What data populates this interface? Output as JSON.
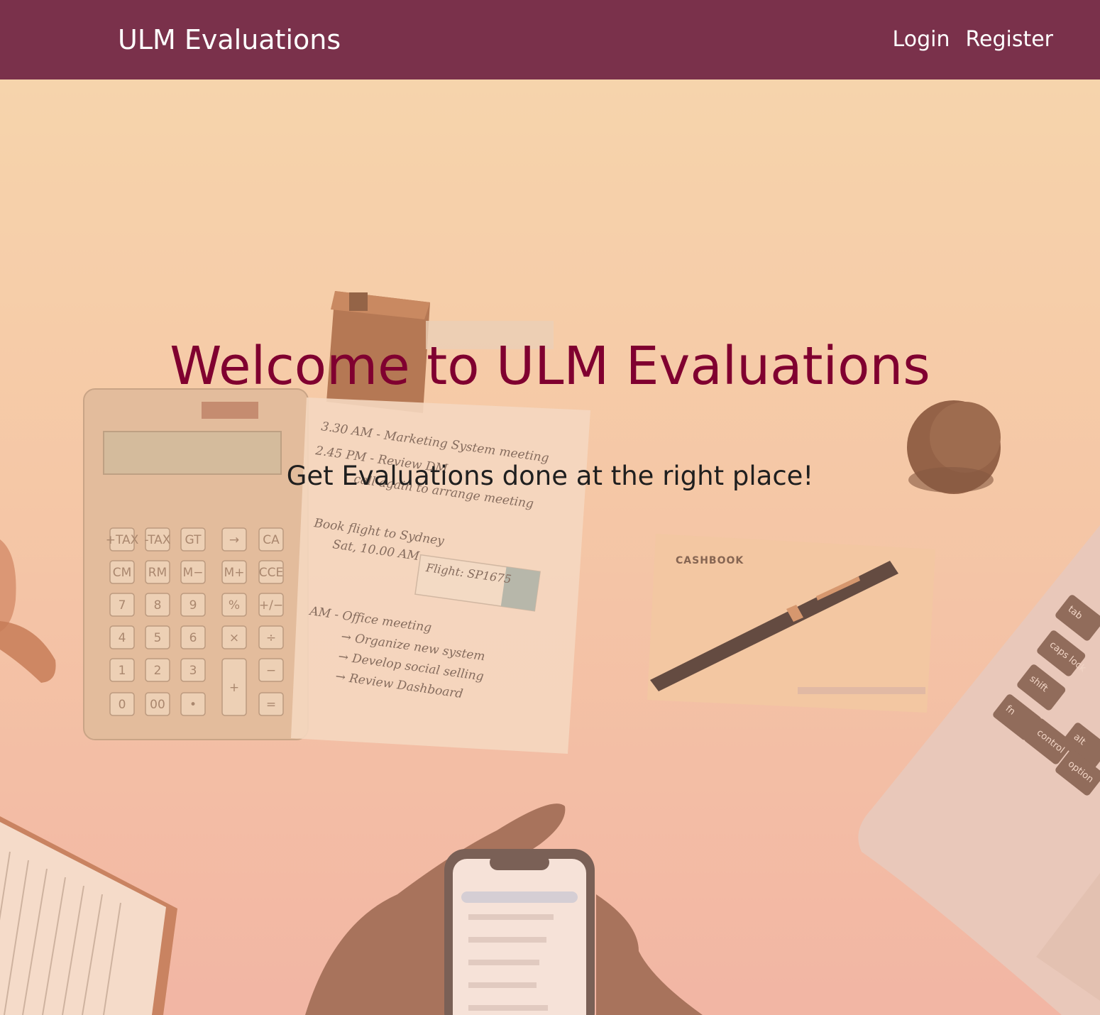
{
  "navbar": {
    "brand": "ULM Evaluations",
    "links": [
      {
        "label": "Login"
      },
      {
        "label": "Register"
      }
    ],
    "background_color": "#7a314b"
  },
  "hero": {
    "title": "Welcome to ULM Evaluations",
    "subtitle": "Get Evaluations done at the right place!",
    "title_color": "#800030",
    "background_image": "desk-with-calculator-notes-phone-laptop",
    "image_text": {
      "cashbook_label": "CASHBOOK",
      "notes": [
        "3.30 AM - Marketing System meeting",
        "2.45 PM - Review DM",
        "call again to arrange meeting",
        "Book flight to Sydney",
        "Sat, 10.00 AM",
        "Flight: SP1675",
        "AM - Office meeting",
        "→ Organize new system",
        "→ Develop social selling",
        "→ Review Dashboard"
      ],
      "calculator_keys": [
        "+TAX",
        "-TAX",
        "GT",
        "→",
        "CA",
        "CM",
        "RM",
        "M−",
        "M+",
        "CCE",
        "7",
        "8",
        "9",
        "%",
        "+/−",
        "4",
        "5",
        "6",
        "×",
        "÷",
        "1",
        "2",
        "3",
        "+",
        "−",
        "0",
        "00",
        "•",
        "="
      ],
      "laptop_keys": [
        "tab",
        "caps lock",
        "shift",
        "fn",
        "control",
        "alt",
        "option"
      ]
    }
  }
}
